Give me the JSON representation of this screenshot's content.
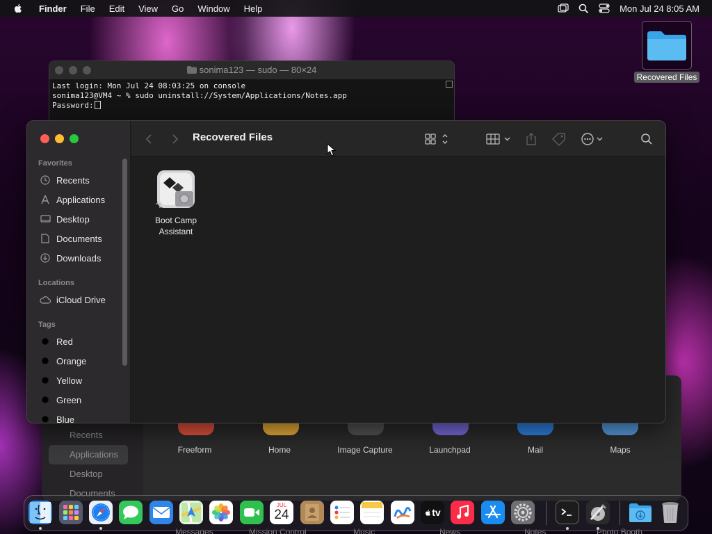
{
  "menubar": {
    "app_name": "Finder",
    "items": [
      "File",
      "Edit",
      "View",
      "Go",
      "Window",
      "Help"
    ],
    "clock": "Mon Jul 24  8:05 AM"
  },
  "desktop": {
    "folder_label": "Recovered Files"
  },
  "terminal": {
    "title": "sonima123 — sudo — 80×24",
    "lines": [
      "Last login: Mon Jul 24 08:03:25 on console",
      "sonima123@VM4 ~ % sudo uninstall://System/Applications/Notes.app",
      "Password:"
    ]
  },
  "finder": {
    "title": "Recovered Files",
    "sidebar": {
      "favorites_heading": "Favorites",
      "favorites": [
        "Recents",
        "Applications",
        "Desktop",
        "Documents",
        "Downloads"
      ],
      "locations_heading": "Locations",
      "locations": [
        "iCloud Drive"
      ],
      "tags_heading": "Tags",
      "tags": [
        "Red",
        "Orange",
        "Yellow",
        "Green",
        "Blue"
      ]
    },
    "files": [
      {
        "line1": "Boot Camp",
        "line2": "Assistant"
      }
    ]
  },
  "background_window": {
    "sidebar_items": [
      "Recents",
      "Applications",
      "Desktop",
      "Documents"
    ],
    "apps_row1": [
      "Freeform",
      "Home",
      "Image Capture",
      "Launchpad",
      "Mail",
      "Maps"
    ],
    "apps_row2_ghost": [
      "Messages",
      "Mission Control",
      "Music",
      "News",
      "Notes",
      "Photo Booth"
    ]
  },
  "dock": {
    "calendar_month": "JUL",
    "calendar_day": "24",
    "tv_label": "tv",
    "colors": {
      "finder": "#3a8ee6",
      "messages": "#34c759",
      "mail": "#2f86e8",
      "facetime": "#30c04f",
      "music": "#fa2d48",
      "appstore": "#1a8cf0"
    }
  }
}
